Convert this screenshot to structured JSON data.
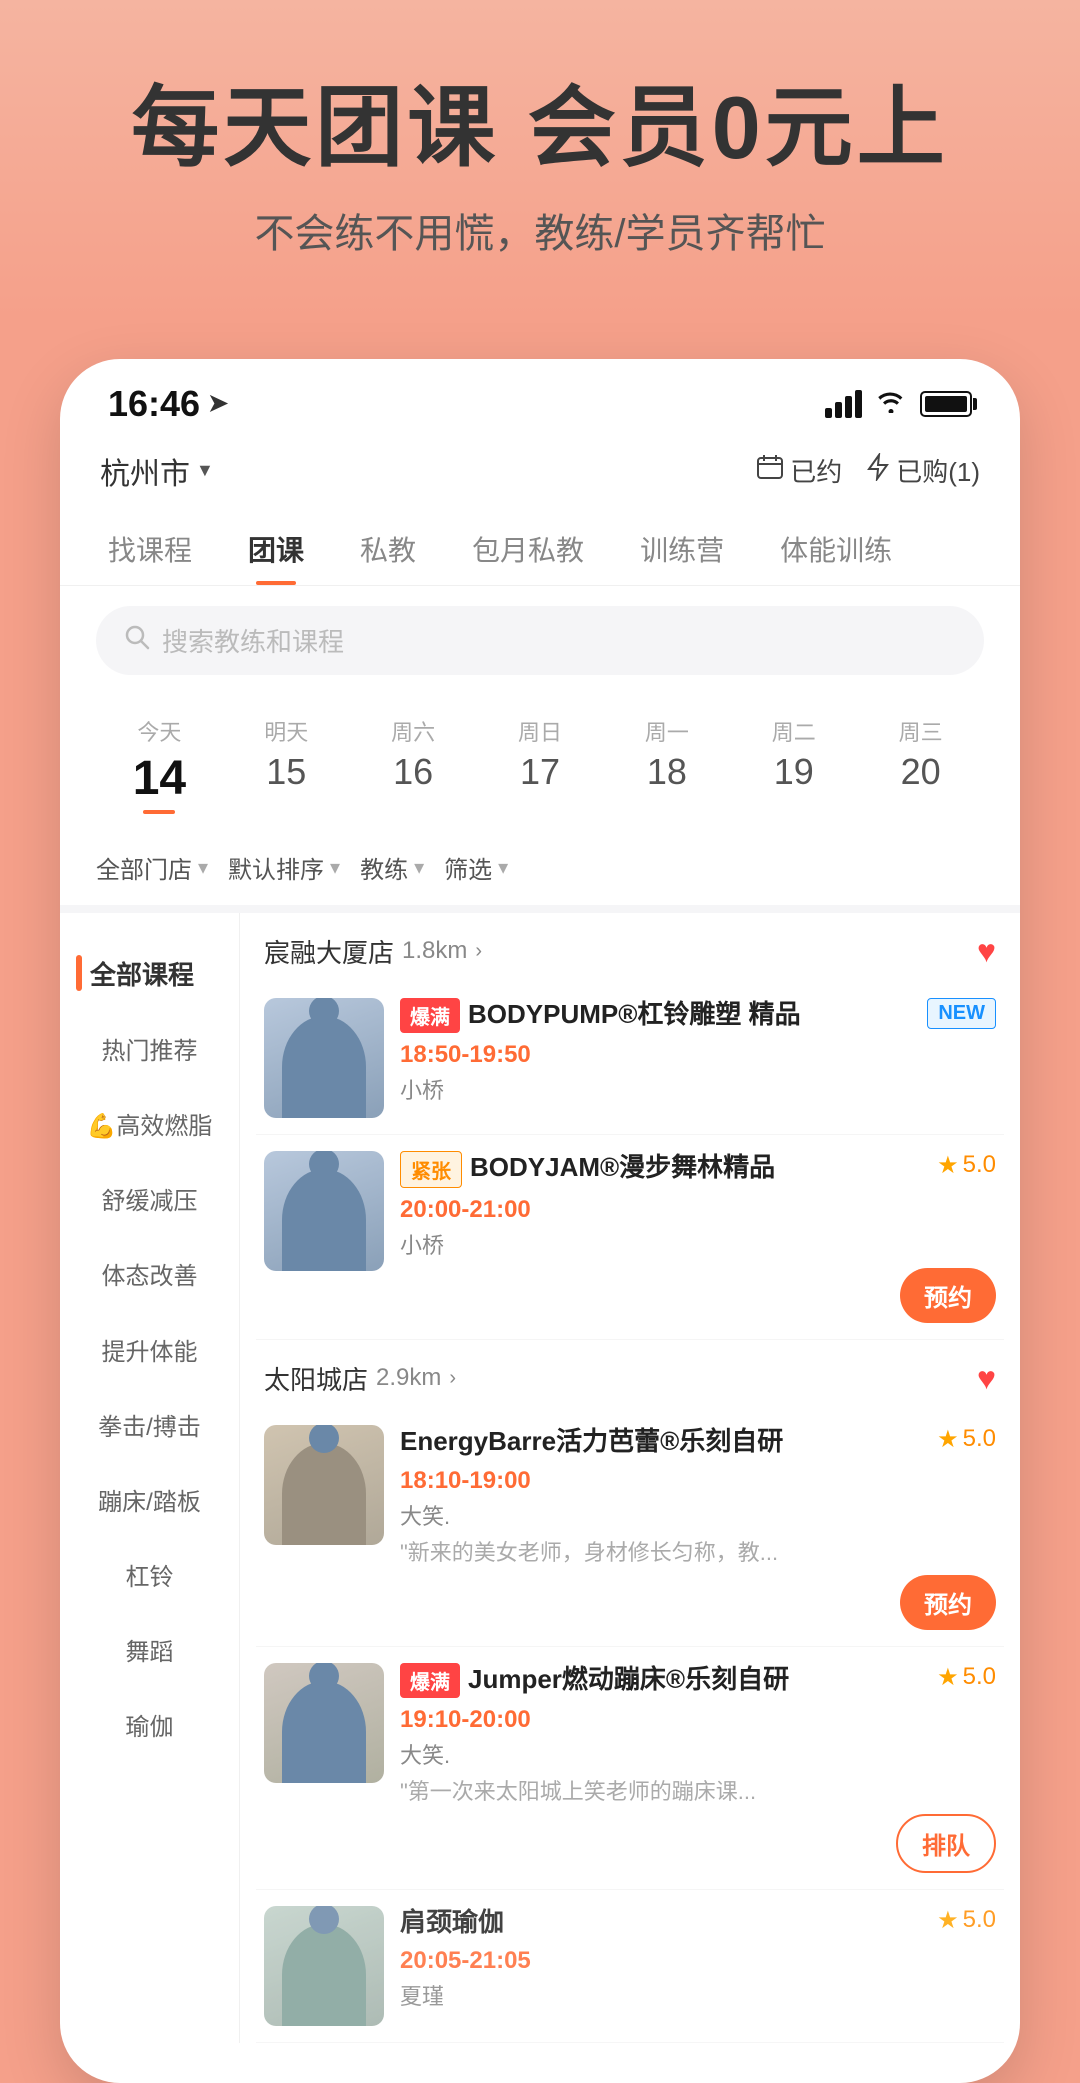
{
  "hero": {
    "title": "每天团课 会员0元上",
    "subtitle": "不会练不用慌，教练/学员齐帮忙"
  },
  "status_bar": {
    "time": "16:46",
    "nav_icon": "➤"
  },
  "top_bar": {
    "city": "杭州市",
    "booked_label": "已约",
    "purchased_label": "已购(1)"
  },
  "nav_tabs": [
    {
      "label": "找课程",
      "active": false
    },
    {
      "label": "团课",
      "active": true
    },
    {
      "label": "私教",
      "active": false
    },
    {
      "label": "包月私教",
      "active": false
    },
    {
      "label": "训练营",
      "active": false
    },
    {
      "label": "体能训练",
      "active": false
    }
  ],
  "search": {
    "placeholder": "搜索教练和课程"
  },
  "dates": [
    {
      "label": "今天",
      "num": "14",
      "today": true
    },
    {
      "label": "明天",
      "num": "15",
      "today": false
    },
    {
      "label": "周六",
      "num": "16",
      "today": false
    },
    {
      "label": "周日",
      "num": "17",
      "today": false
    },
    {
      "label": "周一",
      "num": "18",
      "today": false
    },
    {
      "label": "周二",
      "num": "19",
      "today": false
    },
    {
      "label": "周三",
      "num": "20",
      "today": false
    }
  ],
  "filters": [
    {
      "label": "全部门店"
    },
    {
      "label": "默认排序"
    },
    {
      "label": "教练"
    },
    {
      "label": "筛选"
    }
  ],
  "sidebar": {
    "active": "全部课程",
    "items": [
      "热门推荐",
      "💪高效燃脂",
      "舒缓减压",
      "体态改善",
      "提升体能",
      "拳击/搏击",
      "蹦床/踏板",
      "杠铃",
      "舞蹈",
      "瑜伽"
    ]
  },
  "stores": [
    {
      "name": "宸融大厦店",
      "dist": "1.8km",
      "favorited": true,
      "courses": [
        {
          "tag": "爆满",
          "tag_type": "red",
          "name": "BODYPUMP®杠铃雕塑 精品",
          "badge": "NEW",
          "time": "18:50-19:50",
          "trainer": "小桥",
          "rating": null,
          "desc": "",
          "action": "none",
          "thumb_color": "#b0bed0"
        },
        {
          "tag": "紧张",
          "tag_type": "yellow",
          "name": "BODYJAM®漫步舞林精品",
          "badge": null,
          "time": "20:00-21:00",
          "trainer": "小桥",
          "rating": "5.0",
          "desc": "",
          "action": "reserve",
          "thumb_color": "#b0bed0"
        }
      ]
    },
    {
      "name": "太阳城店",
      "dist": "2.9km",
      "favorited": true,
      "courses": [
        {
          "tag": null,
          "tag_type": null,
          "name": "EnergyBarre活力芭蕾®乐刻自研",
          "badge": null,
          "time": "18:10-19:00",
          "trainer": "大笑.",
          "rating": "5.0",
          "desc": "\"新来的美女老师，身材修长匀称，教...",
          "action": "reserve",
          "thumb_color": "#c8c0b0"
        },
        {
          "tag": "爆满",
          "tag_type": "red",
          "name": "Jumper燃动蹦床®乐刻自研",
          "badge": null,
          "time": "19:10-20:00",
          "trainer": "大笑.",
          "rating": "5.0",
          "desc": "\"第一次来太阳城上笑老师的蹦床课...",
          "action": "queue",
          "thumb_color": "#c8c0b0"
        },
        {
          "tag": null,
          "tag_type": null,
          "name": "肩颈瑜伽",
          "badge": null,
          "time": "20:05-21:05",
          "trainer": "夏瑾",
          "rating": "5.0",
          "desc": "",
          "action": "reserve",
          "thumb_color": "#b8c8c0"
        }
      ]
    }
  ]
}
